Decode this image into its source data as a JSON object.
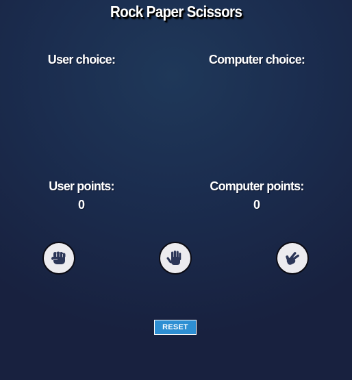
{
  "title": "Rock Paper Scissors",
  "user": {
    "choice_label": "User choice:",
    "points_label": "User points:",
    "points": "0"
  },
  "computer": {
    "choice_label": "Computer choice:",
    "points_label": "Computer points:",
    "points": "0"
  },
  "choices": [
    {
      "name": "rock",
      "icon": "fist-icon"
    },
    {
      "name": "paper",
      "icon": "open-hand-icon"
    },
    {
      "name": "scissors",
      "icon": "victory-hand-icon"
    }
  ],
  "reset_label": "RESET",
  "colors": {
    "background": "#1b2d4f",
    "icon": "#2c3658",
    "button_face": "#ecebef",
    "reset": "#2e8fd3"
  }
}
